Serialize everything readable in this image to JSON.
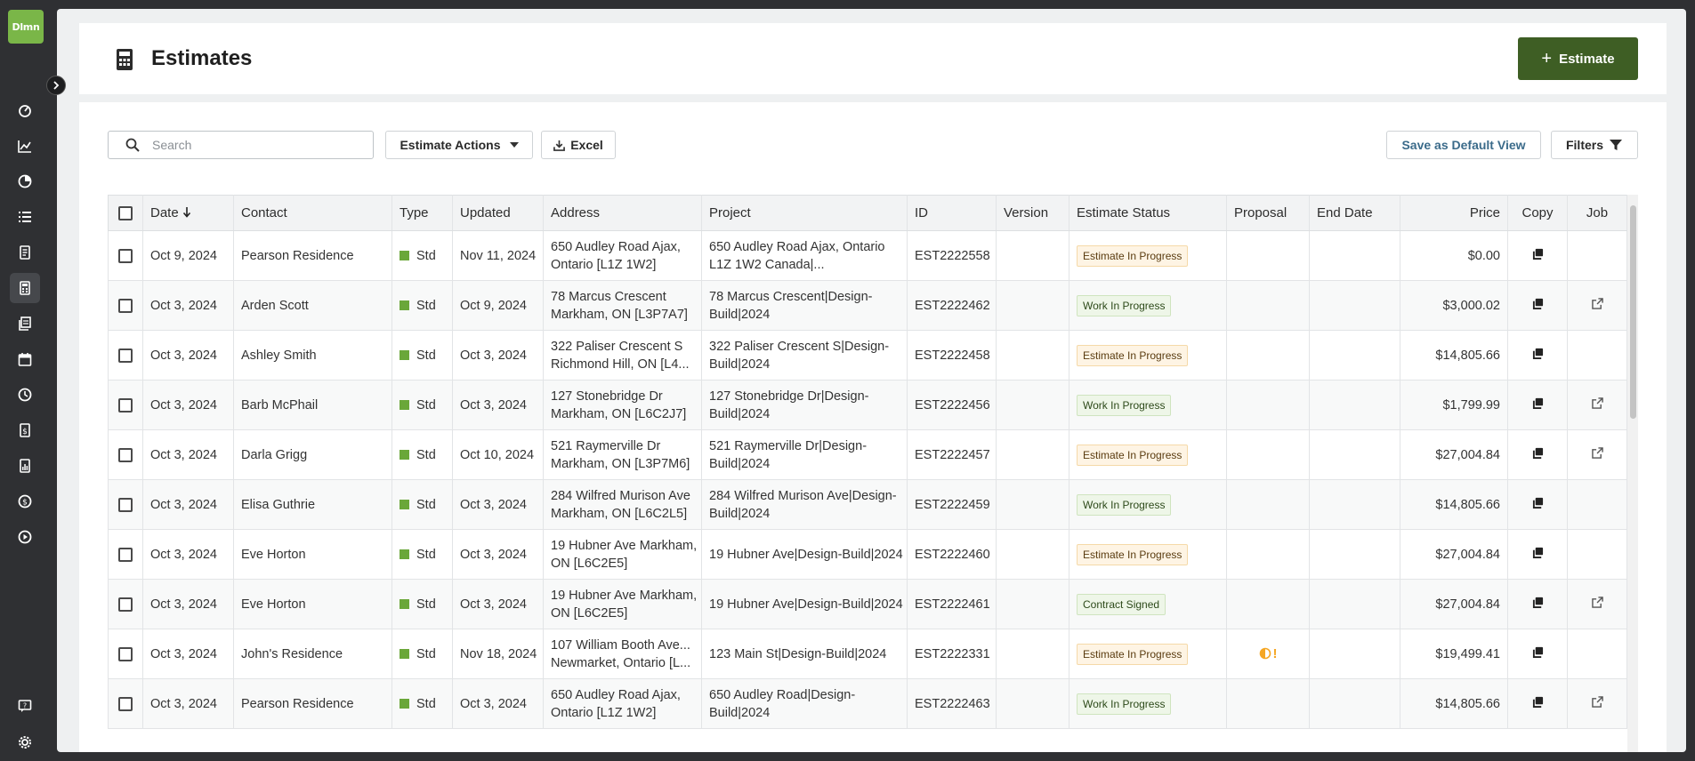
{
  "app": {
    "logo_text": "Dlmn"
  },
  "page": {
    "title": "Estimates",
    "add_button_label": "Estimate"
  },
  "toolbar": {
    "search_placeholder": "Search",
    "actions_label": "Estimate Actions",
    "excel_label": "Excel",
    "default_view_label": "Save as Default View",
    "filters_label": "Filters"
  },
  "table": {
    "headers": {
      "date": "Date",
      "contact": "Contact",
      "type": "Type",
      "updated": "Updated",
      "address": "Address",
      "project": "Project",
      "id": "ID",
      "version": "Version",
      "status": "Estimate Status",
      "proposal": "Proposal",
      "end_date": "End Date",
      "price": "Price",
      "copy": "Copy",
      "job": "Job"
    },
    "rows": [
      {
        "date": "Oct 9, 2024",
        "contact": "Pearson Residence",
        "type": "Std",
        "updated": "Nov 11, 2024",
        "address": "650 Audley Road Ajax, Ontario [L1Z 1W2]",
        "project": "650 Audley Road Ajax, Ontario L1Z 1W2 Canada|...",
        "id": "EST2222558",
        "version": "",
        "status": "Estimate In Progress",
        "status_kind": "prog",
        "proposal": "",
        "end_date": "",
        "price": "$0.00",
        "has_job": false
      },
      {
        "date": "Oct 3, 2024",
        "contact": "Arden Scott",
        "type": "Std",
        "updated": "Oct 9, 2024",
        "address": "78 Marcus Crescent Markham, ON [L3P7A7]",
        "project": "78 Marcus Crescent|Design-Build|2024",
        "id": "EST2222462",
        "version": "",
        "status": "Work In Progress",
        "status_kind": "work",
        "proposal": "",
        "end_date": "",
        "price": "$3,000.02",
        "has_job": true
      },
      {
        "date": "Oct 3, 2024",
        "contact": "Ashley Smith",
        "type": "Std",
        "updated": "Oct 3, 2024",
        "address": "322 Paliser Crescent S Richmond Hill, ON [L4...",
        "project": "322 Paliser Crescent S|Design-Build|2024",
        "id": "EST2222458",
        "version": "",
        "status": "Estimate In Progress",
        "status_kind": "prog",
        "proposal": "",
        "end_date": "",
        "price": "$14,805.66",
        "has_job": false
      },
      {
        "date": "Oct 3, 2024",
        "contact": "Barb McPhail",
        "type": "Std",
        "updated": "Oct 3, 2024",
        "address": "127 Stonebridge Dr Markham, ON [L6C2J7]",
        "project": "127 Stonebridge Dr|Design-Build|2024",
        "id": "EST2222456",
        "version": "",
        "status": "Work In Progress",
        "status_kind": "work",
        "proposal": "",
        "end_date": "",
        "price": "$1,799.99",
        "has_job": true
      },
      {
        "date": "Oct 3, 2024",
        "contact": "Darla Grigg",
        "type": "Std",
        "updated": "Oct 10, 2024",
        "address": "521 Raymerville Dr Markham, ON [L3P7M6]",
        "project": "521 Raymerville Dr|Design-Build|2024",
        "id": "EST2222457",
        "version": "",
        "status": "Estimate In Progress",
        "status_kind": "prog",
        "proposal": "",
        "end_date": "",
        "price": "$27,004.84",
        "has_job": true
      },
      {
        "date": "Oct 3, 2024",
        "contact": "Elisa Guthrie",
        "type": "Std",
        "updated": "Oct 3, 2024",
        "address": "284 Wilfred Murison Ave Markham, ON [L6C2L5]",
        "project": "284 Wilfred Murison Ave|Design-Build|2024",
        "id": "EST2222459",
        "version": "",
        "status": "Work In Progress",
        "status_kind": "work",
        "proposal": "",
        "end_date": "",
        "price": "$14,805.66",
        "has_job": false
      },
      {
        "date": "Oct 3, 2024",
        "contact": "Eve Horton",
        "type": "Std",
        "updated": "Oct 3, 2024",
        "address": "19 Hubner Ave Markham, ON [L6C2E5]",
        "project": "19 Hubner Ave|Design-Build|2024",
        "id": "EST2222460",
        "version": "",
        "status": "Estimate In Progress",
        "status_kind": "prog",
        "proposal": "",
        "end_date": "",
        "price": "$27,004.84",
        "has_job": false
      },
      {
        "date": "Oct 3, 2024",
        "contact": "Eve Horton",
        "type": "Std",
        "updated": "Oct 3, 2024",
        "address": "19 Hubner Ave Markham, ON [L6C2E5]",
        "project": "19 Hubner Ave|Design-Build|2024",
        "id": "EST2222461",
        "version": "",
        "status": "Contract Signed",
        "status_kind": "signed",
        "proposal": "",
        "end_date": "",
        "price": "$27,004.84",
        "has_job": true
      },
      {
        "date": "Oct 3, 2024",
        "contact": "John's Residence",
        "type": "Std",
        "updated": "Nov 18, 2024",
        "address": "107 William Booth Ave... Newmarket, Ontario [L...",
        "project": "123 Main St|Design-Build|2024",
        "id": "EST2222331",
        "version": "",
        "status": "Estimate In Progress",
        "status_kind": "prog",
        "proposal": "!",
        "end_date": "",
        "price": "$19,499.41",
        "has_job": false
      },
      {
        "date": "Oct 3, 2024",
        "contact": "Pearson Residence",
        "type": "Std",
        "updated": "Oct 3, 2024",
        "address": "650 Audley Road Ajax, Ontario [L1Z 1W2]",
        "project": "650 Audley Road|Design-Build|2024",
        "id": "EST2222463",
        "version": "",
        "status": "Work In Progress",
        "status_kind": "work",
        "proposal": "",
        "end_date": "",
        "price": "$14,805.66",
        "has_job": true
      }
    ]
  },
  "colors": {
    "sidebar_bg": "#2f3033",
    "brand_green": "#7ab648",
    "primary_button": "#3e5e24",
    "type_indicator": "#6aa739",
    "proposal_warning": "#f5a623"
  },
  "icons": {
    "sidebar": [
      "dashboard-icon",
      "chart-line-icon",
      "pie-chart-icon",
      "list-icon",
      "document-icon",
      "calculator-icon",
      "invoice-icon",
      "calendar-icon",
      "clock-icon",
      "receipt-icon",
      "report-icon",
      "coin-icon",
      "play-icon",
      "help-icon",
      "gear-icon"
    ]
  }
}
